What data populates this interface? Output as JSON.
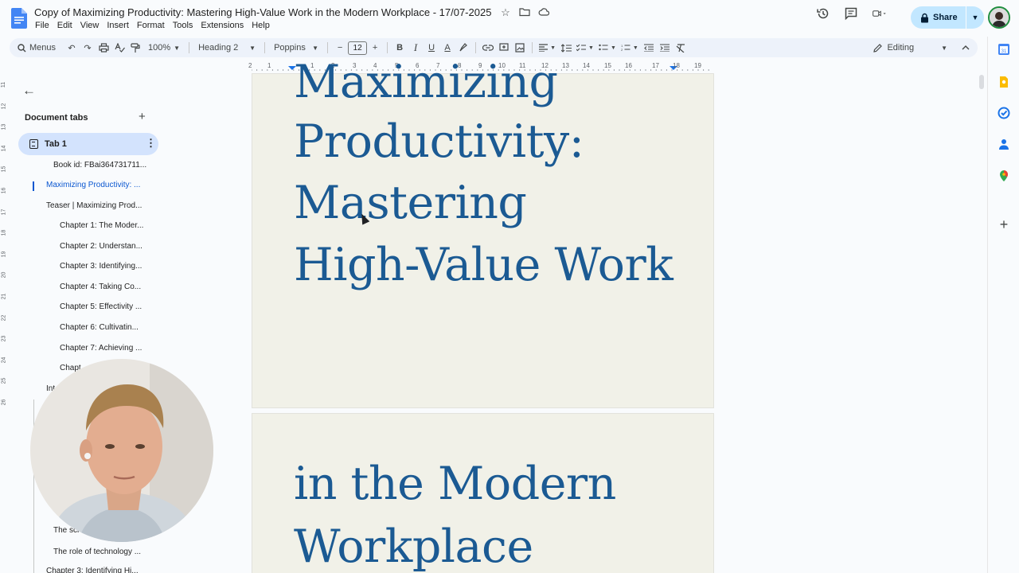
{
  "header": {
    "doc_title": "Copy of Maximizing Productivity: Mastering High-Value Work in the Modern Workplace - 17/07-2025",
    "menus": [
      "File",
      "Edit",
      "View",
      "Insert",
      "Format",
      "Tools",
      "Extensions",
      "Help"
    ],
    "share_label": "Share"
  },
  "toolbar": {
    "menus_label": "Menus",
    "zoom": "100%",
    "style": "Heading 2",
    "font": "Poppins",
    "font_size": "12",
    "bold": "B",
    "italic": "I",
    "underline": "U",
    "text_color": "A",
    "mode": "Editing"
  },
  "ruler": {
    "horizontal": [
      "2",
      "1",
      "1",
      "2",
      "3",
      "4",
      "5",
      "6",
      "7",
      "8",
      "9",
      "10",
      "11",
      "12",
      "13",
      "14",
      "15",
      "16",
      "17",
      "18",
      "19"
    ],
    "vertical": [
      "11",
      "12",
      "13",
      "14",
      "15",
      "16",
      "17",
      "18",
      "19",
      "20",
      "21",
      "22",
      "23",
      "24",
      "25",
      "26"
    ]
  },
  "outline": {
    "header": "Document tabs",
    "tab_label": "Tab 1",
    "items": [
      {
        "text": "Book id: FBai364731711...",
        "level": 2,
        "active": false
      },
      {
        "text": "Maximizing Productivity: ...",
        "level": 1,
        "active": true
      },
      {
        "text": "Teaser | Maximizing Prod...",
        "level": 1,
        "active": false
      },
      {
        "text": "Chapter 1: The Moder...",
        "level": 3,
        "active": false
      },
      {
        "text": "Chapter 2: Understan...",
        "level": 3,
        "active": false
      },
      {
        "text": "Chapter 3: Identifying...",
        "level": 3,
        "active": false
      },
      {
        "text": "Chapter 4: Taking Co...",
        "level": 3,
        "active": false
      },
      {
        "text": "Chapter 5: Effectivity ...",
        "level": 3,
        "active": false
      },
      {
        "text": "Chapter 6: Cultivatin...",
        "level": 3,
        "active": false
      },
      {
        "text": "Chapter 7: Achieving ...",
        "level": 3,
        "active": false
      },
      {
        "text": "Chapt",
        "level": 3,
        "active": false
      },
      {
        "text": "Int",
        "level": 1,
        "active": false
      },
      {
        "text": "The sci",
        "level": 2,
        "active": false
      },
      {
        "text": "The role of technology ...",
        "level": 2,
        "active": false
      },
      {
        "text": "Chapter 3: Identifying Hi...",
        "level": 1,
        "active": false
      }
    ]
  },
  "document": {
    "page1_lines": [
      "Maximizing",
      "Productivity:",
      "Mastering",
      "High-Value Work"
    ],
    "page2_lines": [
      "in the Modern",
      "Workplace"
    ]
  },
  "colors": {
    "heading": "#1b5a93",
    "share_bg": "#c2e7ff",
    "active_tab": "#d3e3fd",
    "page_bg": "#f1f1e8"
  }
}
